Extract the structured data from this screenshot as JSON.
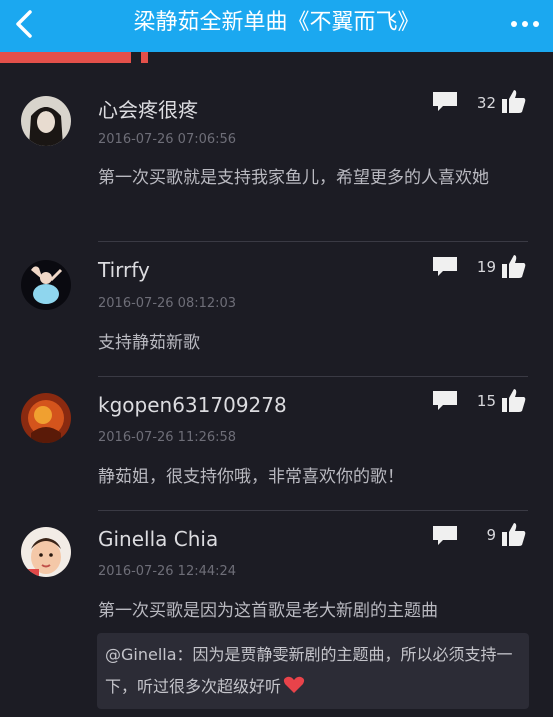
{
  "header": {
    "title": "梁静茹全新单曲《不翼而飞》",
    "bar_color": "#1ba8f0"
  },
  "progress": {
    "fraction": 0.24
  },
  "comments": [
    {
      "username": "心会疼很疼",
      "date": "2016-07-26 07:06:56",
      "likes": "32",
      "text": "第一次买歌就是支持我家鱼儿，希望更多的人喜欢她"
    },
    {
      "username": "Tirrfy",
      "date": "2016-07-26 08:12:03",
      "likes": "19",
      "text": "支持静茹新歌"
    },
    {
      "username": "kgopen631709278",
      "date": "2016-07-26 11:26:58",
      "likes": "15",
      "text": "静茹姐，很支持你哦，非常喜欢你的歌！"
    },
    {
      "username": "Ginella Chia",
      "date": "2016-07-26 12:44:24",
      "likes": "9",
      "text": "第一次买歌是因为这首歌是老大新剧的主题曲",
      "quote": "@Ginella：因为是贾静雯新剧的主题曲，所以必须支持一下，听过很多次超级好听"
    }
  ],
  "icons": {
    "back": "chevron-left-icon",
    "more": "more-dots-icon",
    "reply": "speech-bubble-icon",
    "like": "thumbs-up-icon",
    "heart": "heart-icon"
  },
  "colors": {
    "background": "#1c1c24",
    "accent_red": "#e3504a",
    "heart": "#e8434a"
  }
}
